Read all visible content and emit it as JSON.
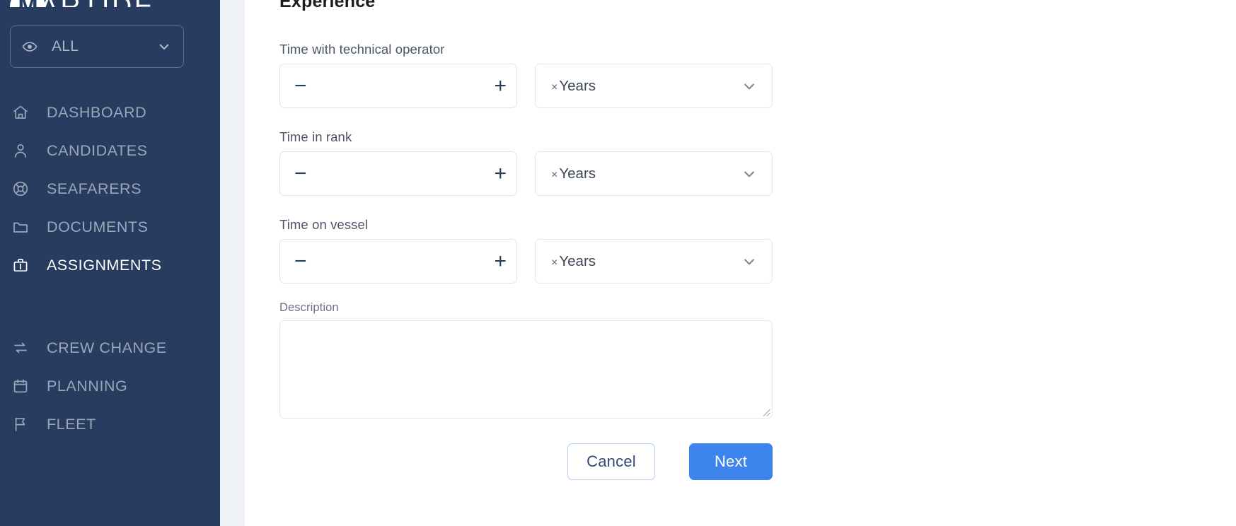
{
  "app": {
    "brand_mark": "M",
    "brand_name": "ARTIDE",
    "sidebar_bg": "#273c5f",
    "accent_blue": "#3d85ec"
  },
  "sidebar": {
    "scope_selector": {
      "icon": "eye-icon",
      "value": "ALL",
      "chevron": "chevron-down-icon"
    },
    "items": [
      {
        "label": "DASHBOARD",
        "icon": "home-icon",
        "active": false
      },
      {
        "label": "CANDIDATES",
        "icon": "user-icon",
        "active": false
      },
      {
        "label": "SEAFARERS",
        "icon": "lifebuoy-icon",
        "active": false
      },
      {
        "label": "DOCUMENTS",
        "icon": "folder-icon",
        "active": false
      },
      {
        "label": "ASSIGNMENTS",
        "icon": "briefcase-icon",
        "active": true
      },
      {
        "label": "CREW CHANGE",
        "icon": "exchange-icon",
        "active": false
      },
      {
        "label": "PLANNING",
        "icon": "calendar-icon",
        "active": false
      },
      {
        "label": "FLEET",
        "icon": "flag-icon",
        "active": false
      }
    ]
  },
  "main": {
    "section_title": "Experience",
    "fields": [
      {
        "label": "Time with technical operator",
        "value": "",
        "minus": "−",
        "plus": "+",
        "unit_chip_remove": "×",
        "unit_chip_label": "Years",
        "unit_chevron": "chevron-down-icon"
      },
      {
        "label": "Time in rank",
        "value": "",
        "minus": "−",
        "plus": "+",
        "unit_chip_remove": "×",
        "unit_chip_label": "Years",
        "unit_chevron": "chevron-down-icon"
      },
      {
        "label": "Time on vessel",
        "value": "",
        "minus": "−",
        "plus": "+",
        "unit_chip_remove": "×",
        "unit_chip_label": "Years",
        "unit_chevron": "chevron-down-icon"
      }
    ],
    "description": {
      "label": "Description",
      "value": "",
      "placeholder": ""
    },
    "actions": {
      "cancel_label": "Cancel",
      "next_label": "Next"
    }
  }
}
